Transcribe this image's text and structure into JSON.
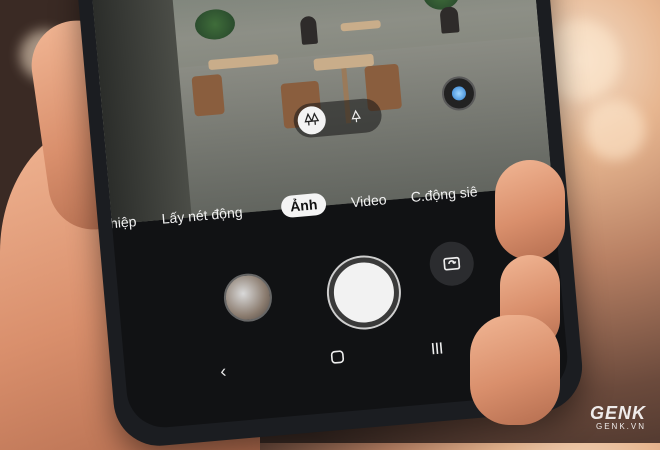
{
  "camera": {
    "modes": [
      "hiệp",
      "Lấy nét động",
      "Ảnh",
      "Video",
      "C.động siê"
    ],
    "selected_mode": "Ảnh"
  },
  "watermark": {
    "logo": "GENK",
    "url": "GENK.VN"
  },
  "icons": [
    "tree-icon",
    "single-tree-icon",
    "scene-optimizer-icon",
    "switch-camera-icon",
    "back-icon",
    "home-icon",
    "recents-icon"
  ]
}
